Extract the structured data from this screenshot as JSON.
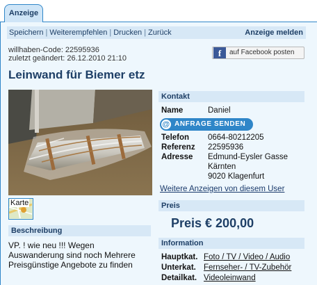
{
  "tab": {
    "label": "Anzeige"
  },
  "toolbar": {
    "links": [
      "Speichern",
      "Weiterempfehlen",
      "Drucken",
      "Zurück"
    ],
    "report_label": "Anzeige melden"
  },
  "meta": {
    "code_line": "willhaben-Code:  22595936",
    "changed_line": "zuletzt geändert:  26.12.2010 21:10"
  },
  "facebook": {
    "icon_letter": "f",
    "label": "auf Facebook posten"
  },
  "ad": {
    "title": "Leinwand für Biemer etz"
  },
  "map": {
    "label": "Karte"
  },
  "beschreibung": {
    "heading": "Beschreibung",
    "lines": [
      "VP. ! wie neu !!! Wegen",
      "Auswanderung sind noch Mehrere",
      "Preisgünstige Angebote zu finden"
    ]
  },
  "kontakt": {
    "heading": "Kontakt",
    "name_label": "Name",
    "name_value": "Daniel",
    "anfrage_label": "ANFRAGE SENDEN",
    "telefon_label": "Telefon",
    "telefon_value": "0664-80212205",
    "referenz_label": "Referenz",
    "referenz_value": "22595936",
    "adresse_label": "Adresse",
    "adresse_lines": [
      "Edmund-Eysler Gasse",
      "Kärnten",
      "9020 Klagenfurt"
    ],
    "more_link": "Weitere Anzeigen von diesem User"
  },
  "preis": {
    "heading": "Preis",
    "value": "Preis € 200,00"
  },
  "information": {
    "heading": "Information",
    "hauptkat_label": "Hauptkat.",
    "hauptkat_value": "Foto / TV / Video / Audio",
    "unterkat_label": "Unterkat.",
    "unterkat_value": "Fernseher- / TV-Zubehör",
    "detailkat_label": "Detailkat.",
    "detailkat_value": "Videoleinwand"
  }
}
